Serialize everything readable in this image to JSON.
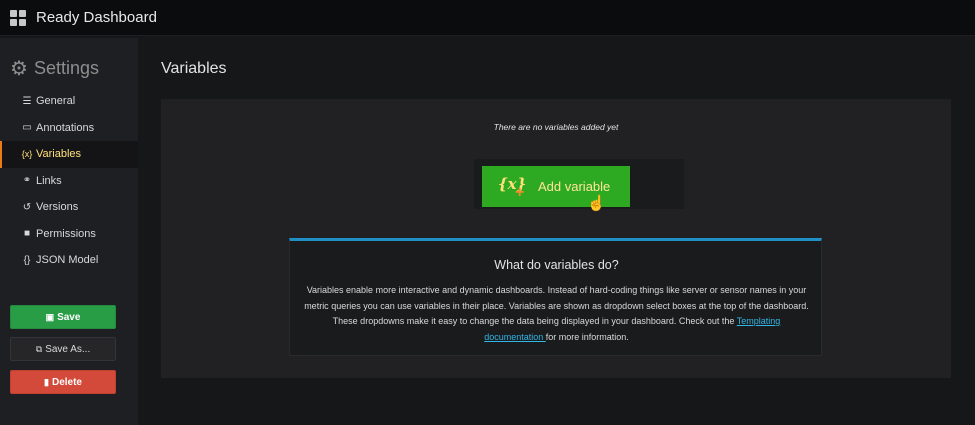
{
  "header": {
    "title": "Ready Dashboard",
    "icon": "grid-icon"
  },
  "sidebar": {
    "heading": "Settings",
    "heading_icon": "gear-icon",
    "active_color": "#eb7b18",
    "items": [
      {
        "label": "General",
        "icon": "sliders-icon"
      },
      {
        "label": "Annotations",
        "icon": "comment-icon"
      },
      {
        "label": "Variables",
        "icon": "variable-icon",
        "active": true
      },
      {
        "label": "Links",
        "icon": "link-icon"
      },
      {
        "label": "Versions",
        "icon": "history-icon"
      },
      {
        "label": "Permissions",
        "icon": "lock-icon"
      },
      {
        "label": "JSON Model",
        "icon": "json-icon"
      }
    ],
    "buttons": {
      "save": "Save",
      "save_as": "Save As...",
      "delete": "Delete"
    }
  },
  "main": {
    "title": "Variables",
    "empty_message": "There are no variables added yet",
    "add_button": {
      "label": "Add variable",
      "color": "#2eaa22"
    },
    "info": {
      "title": "What do variables do?",
      "body_before_link": "Variables enable more interactive and dynamic dashboards. Instead of hard-coding things like server or sensor names in your metric queries you can use variables in their place. Variables are shown as dropdown select boxes at the top of the dashboard. These dropdowns make it easy to change the data being displayed in your dashboard. Check out the ",
      "link_text": "Templating documentation ",
      "body_after_link": "for more information.",
      "accent_color": "#1f8fc5"
    }
  }
}
